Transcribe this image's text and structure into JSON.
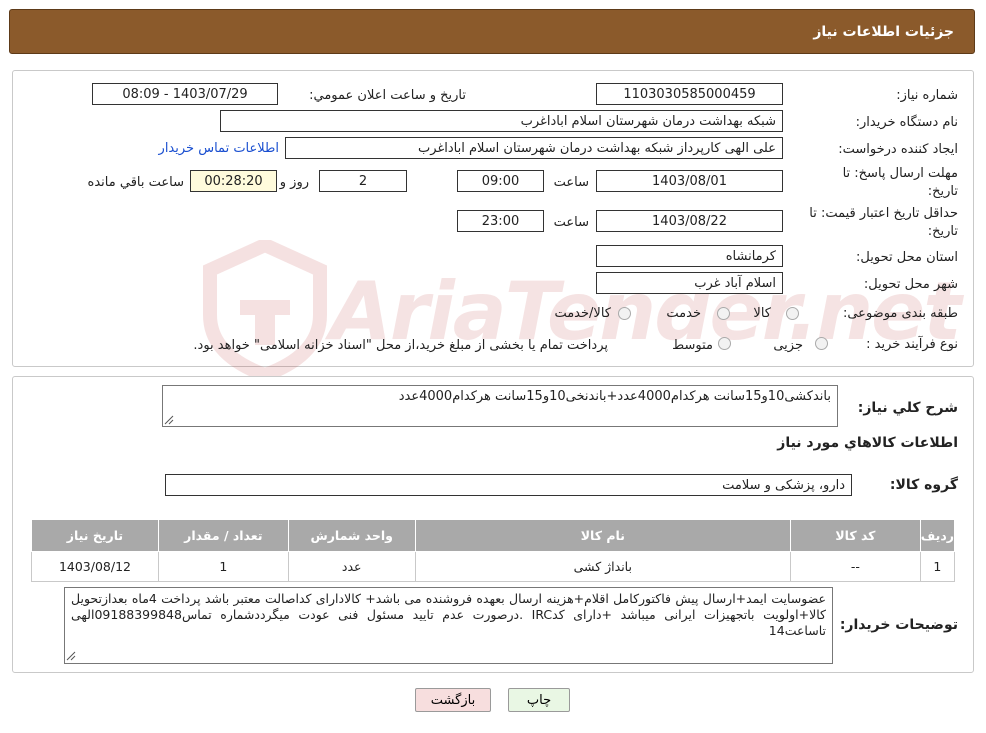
{
  "header": {
    "title": "جزئیات اطلاعات نیاز"
  },
  "form": {
    "need_number_label": "شماره نیاز:",
    "need_number": "1103030585000459",
    "announce_label": "تاریخ و ساعت اعلان عمومي:",
    "announce_value": "1403/07/29 - 08:09",
    "buyer_org_label": "نام دستگاه خريدار:",
    "buyer_org": "شبکه بهداشت درمان شهرستان اسلام اباداغرب",
    "requester_label": "ايجاد کننده درخواست:",
    "requester": "علی الهی کارپرداز شبکه بهداشت درمان شهرستان اسلام اباداغرب",
    "contact_link": "اطلاعات تماس خریدار",
    "deadline_label_1": "مهلت ارسال پاسخ: تا",
    "deadline_label_2": "تاریخ:",
    "deadline_date": "1403/08/01",
    "time_label": "ساعت",
    "deadline_time": "09:00",
    "days_value": "2",
    "days_label": "روز و",
    "remaining_time": "00:28:20",
    "remaining_label": "ساعت باقي مانده",
    "validity_label_1": "حداقل تاريخ اعتبار قيمت: تا",
    "validity_label_2": "تاريخ:",
    "validity_date": "1403/08/22",
    "validity_time": "23:00",
    "province_label": "استان محل تحويل:",
    "province": "کرمانشاه",
    "city_label": "شهر محل تحويل:",
    "city": "اسلام آباد غرب",
    "category_label": "طبقه بندی موضوعی:",
    "category_options": [
      "کالا",
      "خدمت",
      "کالا/خدمت"
    ],
    "process_label": "نوع فرآيند خريد :",
    "process_options": [
      "جزیی",
      "متوسط"
    ],
    "process_note": "پرداخت تمام يا بخشی از مبلغ خريد،از محل \"اسناد خزانه اسلامی\" خواهد بود."
  },
  "summary": {
    "general_desc_label": "شرح کلي نياز:",
    "general_desc": "باندکشی10و15سانت هرکدام4000عدد+باندنخی10و15سانت هرکدام4000عدد",
    "goods_info_title": "اطلاعات کالاهاي مورد نياز",
    "goods_group_label": "گروه کالا:",
    "goods_group": "دارو، پزشکی و سلامت"
  },
  "table": {
    "headers": [
      "رديف",
      "کد کالا",
      "نام کالا",
      "واحد شمارش",
      "تعداد / مقدار",
      "تاريخ نياز"
    ],
    "rows": [
      [
        "1",
        "--",
        "بانداژ کشی",
        "عدد",
        "1",
        "1403/08/12"
      ]
    ]
  },
  "buyer_notes": {
    "label": "توضيحات خريدار:",
    "text": "عضوسایت ایمد+ارسال پیش فاکتورکامل اقلام+هزینه ارسال بعهده فروشنده می باشد+ کالادارای کداصالت معتبر باشد پرداخت 4ماه بعدازتحویل کالا+اولویت باتجهیزات ایرانی میباشد +دارای کدIRC .درصورت عدم تایید مسئول فنی عودت میگرددشماره تماس09188399848الهی تاساعت14"
  },
  "buttons": {
    "print": "چاپ",
    "back": "بازگشت"
  },
  "colors": {
    "header_bg": "#8b5a2b",
    "table_header_bg": "#a9a9a9",
    "link": "#1a4fd0",
    "remaining_bg": "#fffbdc"
  }
}
